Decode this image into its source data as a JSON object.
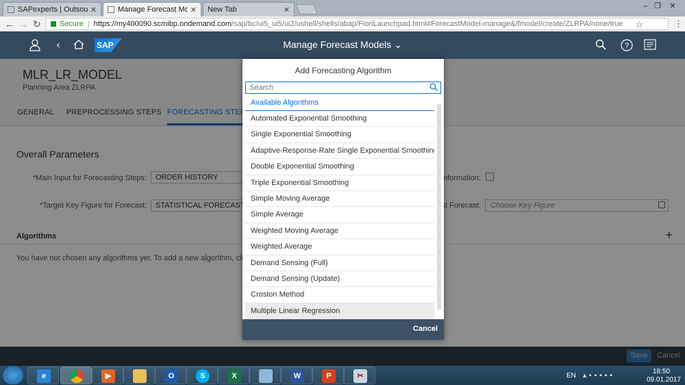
{
  "browser": {
    "tabs": [
      {
        "label": "SAPexperts | Outsourcing"
      },
      {
        "label": "Manage Forecast Models"
      },
      {
        "label": "New Tab"
      }
    ],
    "secure_label": "Secure",
    "url_host": "https://my400090.scmibp.ondemand.com",
    "url_path": "/sap/bc/ui5_ui5/ui2/ushell/shells/abap/FioriLaunchpad.html#ForecastModel-manage&/fmodel/create/ZLRPA/none/true"
  },
  "shell": {
    "logo": "SAP",
    "title": "Manage Forecast Models"
  },
  "header": {
    "object_title": "MLR_LR_MODEL",
    "object_subtitle": "Planning Area ZLRPA"
  },
  "tabs": [
    "GENERAL",
    "PREPROCESSING STEPS",
    "FORECASTING STEPS"
  ],
  "params": {
    "section_title": "Overall Parameters",
    "main_input_label": "Main Input for Forecasting Steps:",
    "main_input_value": "ORDER HISTORY",
    "info_label": "Information:",
    "target_label": "Target Key Figure for Forecast:",
    "target_value": "STATISTICAL FORECAST",
    "ex_post_label": "st Forecast:",
    "ex_post_placeholder": "Choose Key Figure"
  },
  "algorithms": {
    "title": "Algorithms",
    "empty_text": "You have not chosen any algorithms yet. To add a new algorithm, click t"
  },
  "footer": {
    "save": "Save",
    "cancel": "Cancel"
  },
  "dialog": {
    "title": "Add Forecasting Algorithm",
    "search_placeholder": "Search",
    "group_header": "Available Algorithms",
    "items": [
      "Automated Exponential Smoothing",
      "Single Exponential Smoothing",
      "Adaptive-Response-Rate Single Exponential Smoothing",
      "Double Exponential Smoothing",
      "Triple Exponential Smoothing",
      "Simple Moving Average",
      "Simple Average",
      "Weighted Moving Average",
      "Weighted Average",
      "Demand Sensing (Full)",
      "Demand Sensing (Update)",
      "Croston Method",
      "Multiple Linear Regression"
    ],
    "cancel": "Cancel"
  },
  "taskbar": {
    "lang": "EN",
    "time": "18:50",
    "date": "09.01.2017"
  }
}
